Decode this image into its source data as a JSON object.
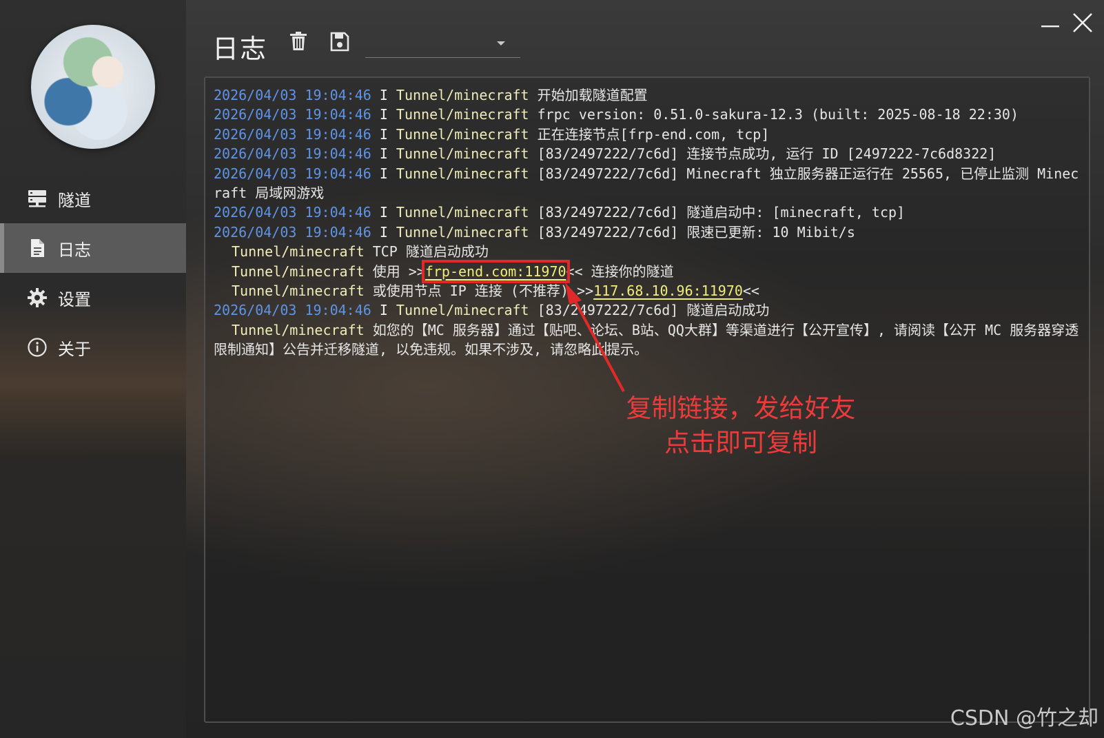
{
  "sidebar": {
    "items": [
      {
        "label": "隧道",
        "icon": "server-icon"
      },
      {
        "label": "日志",
        "icon": "document-icon",
        "active": true
      },
      {
        "label": "设置",
        "icon": "gear-icon"
      },
      {
        "label": "关于",
        "icon": "info-icon"
      }
    ]
  },
  "header": {
    "title": "日志",
    "dropdown_value": ""
  },
  "log": {
    "l1": {
      "ts": "2026/04/03 19:04:46",
      "lvl": "I",
      "src": "Tunnel/minecraft",
      "msg": "开始加载隧道配置"
    },
    "l2": {
      "ts": "2026/04/03 19:04:46",
      "lvl": "I",
      "src": "Tunnel/minecraft",
      "msg": "frpc version: 0.51.0-sakura-12.3 (built: 2025-08-18 22:30)"
    },
    "l3": {
      "ts": "2026/04/03 19:04:46",
      "lvl": "I",
      "src": "Tunnel/minecraft",
      "msg": "正在连接节点[frp-end.com, tcp]"
    },
    "l4": {
      "ts": "2026/04/03 19:04:46",
      "lvl": "I",
      "src": "Tunnel/minecraft",
      "msg": "[83/2497222/7c6d] 连接节点成功, 运行 ID [2497222-7c6d8322]"
    },
    "l5": {
      "ts": "2026/04/03 19:04:46",
      "lvl": "I",
      "src": "Tunnel/minecraft",
      "msg": "[83/2497222/7c6d] Minecraft 独立服务器正运行在 25565, 已停止监测 Minecraft 局域网游戏"
    },
    "l6": {
      "ts": "2026/04/03 19:04:46",
      "lvl": "I",
      "src": "Tunnel/minecraft",
      "msg": "[83/2497222/7c6d] 隧道启动中: [minecraft, tcp]"
    },
    "l7": {
      "ts": "2026/04/03 19:04:46",
      "lvl": "I",
      "src": "Tunnel/minecraft",
      "msg": "[83/2497222/7c6d] 限速已更新: 10 Mibit/s"
    },
    "l8": {
      "src": "Tunnel/minecraft",
      "msg": "TCP 隧道启动成功"
    },
    "l9": {
      "src": "Tunnel/minecraft",
      "pre": "使用 >>",
      "link": "frp-end.com:11970",
      "post": "<< 连接你的隧道"
    },
    "l10": {
      "src": "Tunnel/minecraft",
      "pre": "或使用节点 IP 连接 (不推荐) >>",
      "link": "117.68.10.96:11970",
      "post": "<<"
    },
    "l11": {
      "ts": "2026/04/03 19:04:46",
      "lvl": "I",
      "src": "Tunnel/minecraft",
      "msg": "[83/2497222/7c6d] 隧道启动成功"
    },
    "l12": {
      "src": "Tunnel/minecraft",
      "msg_a": "如您的【MC 服务器】通过【贴吧、论坛、B站、QQ大群】等渠道进行【公开宣传】, 请阅读【公开 MC 服务器穿透限制通知】公告并迁移隧道, 以免违规。如果不涉及, 请忽略此",
      "msg_b": "提示。"
    }
  },
  "annotation": {
    "line1": "复制链接，发给好友",
    "line2": "点击即可复制"
  },
  "watermark": "CSDN @竹之却",
  "colors": {
    "timestamp": "#5f94e6",
    "source": "#f1edb8",
    "link": "#f2ed7c",
    "annotation": "#ec3b3b"
  }
}
